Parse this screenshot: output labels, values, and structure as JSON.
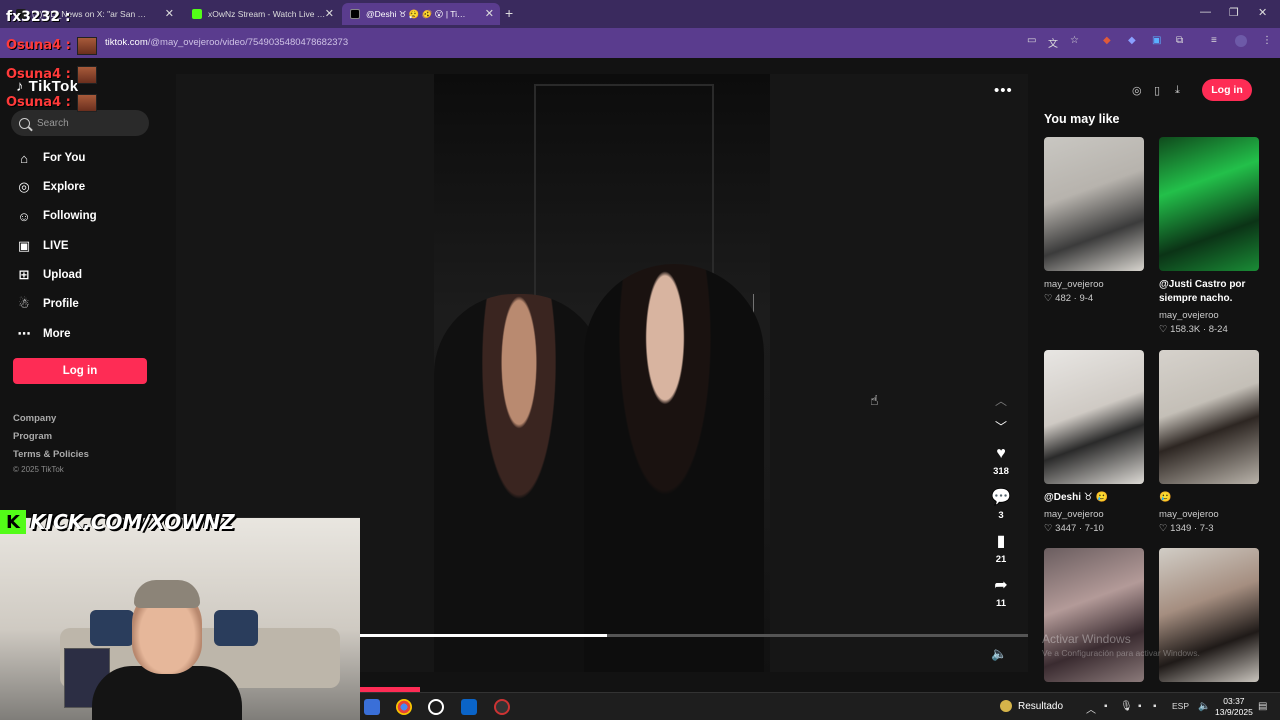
{
  "browser": {
    "tabs": [
      {
        "title": "(3) BD_News on X: \"ar San …",
        "favicon_color": "#1d1d1d"
      },
      {
        "title": "xOwNz Stream - Watch Live on …",
        "favicon_color": "#53fc18"
      },
      {
        "title": "@Deshi ♉ 😮‍💨 🫨 😮 | Ti…",
        "favicon_color": "#000000"
      }
    ],
    "new_tab": "+",
    "url_host": "tiktok.com",
    "url_path": "/@may_ovejeroo/video/7549035480478682373"
  },
  "overlays": {
    "fx": "fx3232 :",
    "osuna": [
      "Osuna4 :",
      "Osuna4 :",
      "Osuna4 :"
    ]
  },
  "sidebar": {
    "logo": "TikTok",
    "search_placeholder": "Search",
    "nav": [
      {
        "label": "For You",
        "icon": "home-icon",
        "glyph": "⌂"
      },
      {
        "label": "Explore",
        "icon": "compass-icon",
        "glyph": "◎"
      },
      {
        "label": "Following",
        "icon": "user-follow-icon",
        "glyph": "☺"
      },
      {
        "label": "LIVE",
        "icon": "live-tv-icon",
        "glyph": "▣"
      },
      {
        "label": "Upload",
        "icon": "upload-plus-icon",
        "glyph": "⊞"
      },
      {
        "label": "Profile",
        "icon": "profile-icon",
        "glyph": "☃"
      },
      {
        "label": "More",
        "icon": "more-dots-icon",
        "glyph": "⋯"
      }
    ],
    "login": "Log in",
    "footer": [
      "Company",
      "Program",
      "Terms & Policies"
    ],
    "copyright": "© 2025 TikTok"
  },
  "video": {
    "likes": "318",
    "comments": "3",
    "saves": "21",
    "shares": "11",
    "progress_percent": 37
  },
  "right": {
    "login": "Log in",
    "title": "You may like",
    "cards": [
      {
        "title": "",
        "user": "may_ovejeroo",
        "likes": "482",
        "date": "9-4",
        "thumb": "linear-gradient(160deg,#c9c7c2 0%,#b7b3ad 40%,#3b3b3b 70%,#d8d5cf 100%)"
      },
      {
        "title": "@Justi Castro por siempre nacho.",
        "user": "may_ovejeroo",
        "likes": "158.3K",
        "date": "8-24",
        "thumb": "linear-gradient(160deg,#0f4a1c 0%,#23c04a 35%,#0b3316 70%,#1a8c36 100%)"
      },
      {
        "title": "@Deshi ♉ 🥲",
        "user": "may_ovejeroo",
        "likes": "3447",
        "date": "7-10",
        "thumb": "linear-gradient(160deg,#e8e6e3 0%,#cfcac4 45%,#2a2a2a 65%,#dedbd6 100%)"
      },
      {
        "title": "🥲",
        "user": "may_ovejeroo",
        "likes": "1349",
        "date": "7-3",
        "thumb": "linear-gradient(160deg,#d6d2cc 0%,#c4bfb7 40%,#2d2622 60%,#b9b3aa 100%)"
      },
      {
        "title": "",
        "user": "",
        "likes": "",
        "date": "",
        "thumb": "linear-gradient(160deg,#6a5d5f 0%,#b39a98 40%,#3a2b30 70%,#8b7a7a 100%)"
      },
      {
        "title": "",
        "user": "",
        "likes": "",
        "date": "",
        "thumb": "linear-gradient(160deg,#d1cdc6 0%,#a58e80 40%,#1f1a18 70%,#c9c4bd 100%)"
      }
    ]
  },
  "watermark": {
    "line1": "Activar Windows",
    "line2": "Ve a Configuración para activar Windows."
  },
  "stream": {
    "banner": "KICK.COM/XOWNZ",
    "logo": "K"
  },
  "taskbar": {
    "result_label": "Resultado",
    "lang": "ESP",
    "time": "03:37",
    "date": "13/9/2025"
  }
}
